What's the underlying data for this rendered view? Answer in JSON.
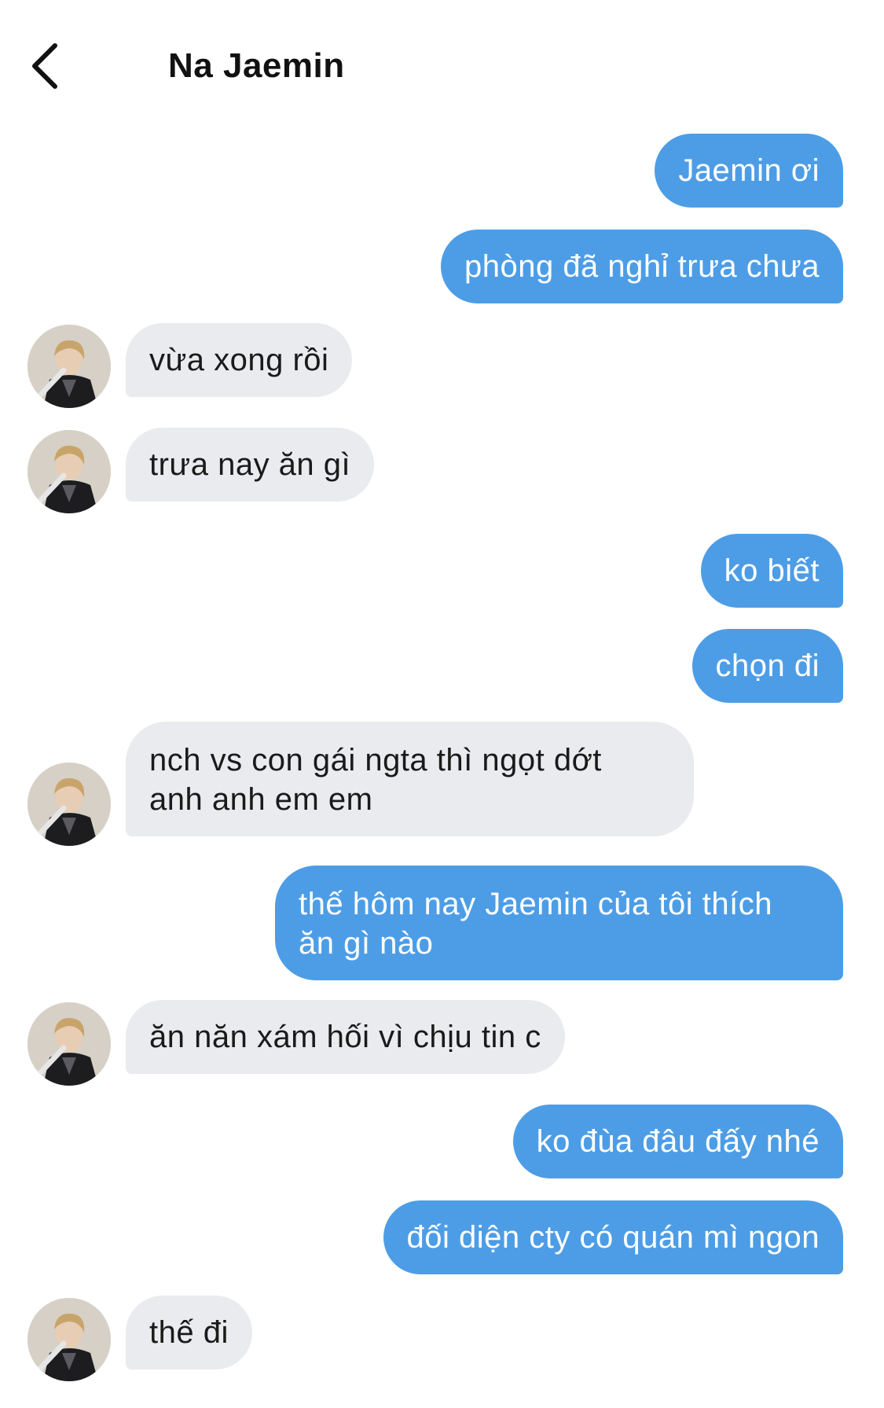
{
  "header": {
    "title": "Na Jaemin"
  },
  "icons": {
    "back": "chevron-left-icon",
    "avatar": "contact-avatar"
  },
  "colors": {
    "outgoing_bubble": "#4d9de6",
    "incoming_bubble": "#e9ebee"
  },
  "messages": [
    {
      "from": "me",
      "text": "Jaemin ơi"
    },
    {
      "from": "me",
      "text": "phòng đã nghỉ trưa chưa"
    },
    {
      "from": "contact",
      "text": "vừa xong rồi"
    },
    {
      "from": "contact",
      "text": "trưa nay ăn gì"
    },
    {
      "from": "me",
      "text": "ko biết"
    },
    {
      "from": "me",
      "text": "chọn đi"
    },
    {
      "from": "contact",
      "text": "nch vs con gái ngta thì ngọt dớt\nanh anh em em"
    },
    {
      "from": "me",
      "text": "thế hôm nay Jaemin của tôi thích\năn gì nào"
    },
    {
      "from": "contact",
      "text": "ăn năn xám hối vì chịu tin c"
    },
    {
      "from": "me",
      "text": "ko đùa đâu đấy nhé"
    },
    {
      "from": "me",
      "text": "đối diện cty có quán mì ngon"
    },
    {
      "from": "contact",
      "text": "thế đi"
    }
  ]
}
